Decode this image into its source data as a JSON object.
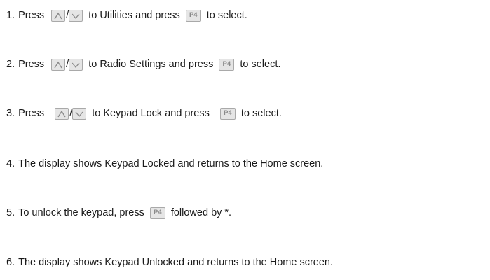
{
  "steps": [
    {
      "num": "1.",
      "before": "Press",
      "mid": "to Utilities and press",
      "after": "to select."
    },
    {
      "num": "2.",
      "before": "Press",
      "mid": "to Radio Settings and press",
      "after": "to select."
    },
    {
      "num": "3.",
      "before": "Press",
      "mid": "to Keypad Lock and press",
      "after": "to select."
    },
    {
      "num": "4.",
      "text": "The display shows Keypad Locked and returns to the Home screen."
    },
    {
      "num": "5.",
      "before": "To unlock the keypad, press",
      "after": "followed by *."
    },
    {
      "num": "6.",
      "text": "The display shows Keypad Unlocked and returns to the Home screen."
    }
  ],
  "keys": {
    "slash": "/",
    "p4_label": "P4",
    "up_icon": "up-arrow-key-icon",
    "down_icon": "down-arrow-key-icon"
  },
  "colors": {
    "text": "#1a1a1a",
    "key_fill": "#e5e5e5",
    "key_border": "#a9a9a9"
  }
}
